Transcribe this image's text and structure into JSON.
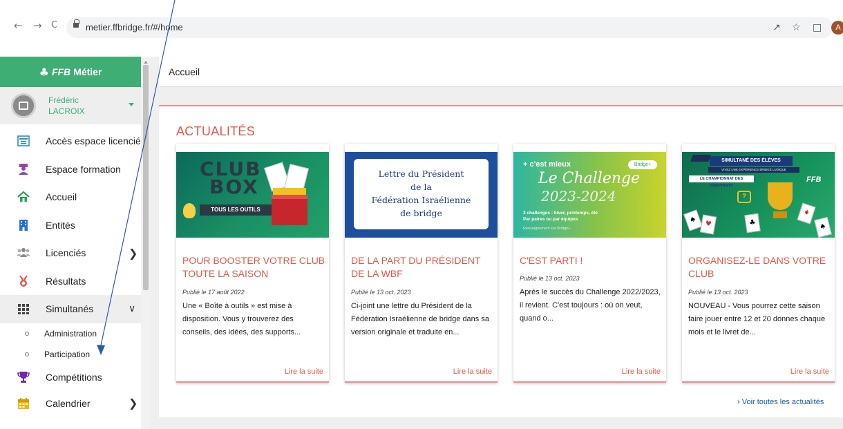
{
  "browser": {
    "url": "metier.ffbridge.fr/#/home",
    "back_icon": "←",
    "forward_icon": "→",
    "reload_icon": "C",
    "profile_initial": "A"
  },
  "sidebar": {
    "brand_ffb": "FFB",
    "brand_metier": "Métier",
    "user_first": "Frédéric",
    "user_last": "LACROIX",
    "items": [
      {
        "label": "Accès espace licencié",
        "icon": "id-card-icon"
      },
      {
        "label": "Espace formation",
        "icon": "graduate-icon"
      },
      {
        "label": "Accueil",
        "icon": "home-icon"
      },
      {
        "label": "Entités",
        "icon": "building-icon"
      },
      {
        "label": "Licenciés",
        "icon": "users-icon"
      },
      {
        "label": "Résultats",
        "icon": "medal-icon"
      },
      {
        "label": "Simultanés",
        "icon": "grid-icon"
      },
      {
        "label": "Compétitions",
        "icon": "trophy-icon"
      },
      {
        "label": "Calendrier",
        "icon": "calendar-icon"
      }
    ],
    "sub_items": [
      {
        "label": "Administration"
      },
      {
        "label": "Participation"
      }
    ]
  },
  "topbar": {
    "title": "Accueil"
  },
  "news": {
    "heading": "ACTUALITÉS",
    "see_all": "Voir toutes les actualités",
    "read_more": "Lire la suite",
    "cards": [
      {
        "title": "POUR BOOSTER VOTRE CLUB TOUTE LA SAISON",
        "date": "Publié le 17 août 2022",
        "text": "Une « Boîte à outils » est mise à disposition. Vous y trouverez des conseils, des idées, des supports...",
        "img_word1": "CLUB",
        "img_word2": "BOX",
        "img_tag": "TOUS LES OUTILS"
      },
      {
        "title": "DE LA PART DU PRÉSIDENT DE LA WBF",
        "date": "Publié le 13 oct. 2023",
        "text": "Ci-joint une lettre du Président de la Fédération Israélienne de bridge dans sa version originale et traduite en...",
        "img_line1": "Lettre du Président",
        "img_line2": "de la",
        "img_line3": "Fédération Israélienne",
        "img_line4": "de bridge"
      },
      {
        "title": "C'EST PARTI !",
        "date": "Publié le 13 oct. 2023",
        "text": "Après le succès du Challenge 2022/2023, il revient. C'est toujours : où on veut, quand o...",
        "img_top": "+ c'est mieux",
        "img_badge": "Bridge+",
        "img_word": "Le Challenge",
        "img_year": "2023-2024",
        "img_small1": "3 challenges : hiver, printemps, été",
        "img_small2": "Par paires ou par équipes",
        "img_foot": "Renseignement sur Bridge+"
      },
      {
        "title": "ORGANISEZ-LE DANS VOTRE CLUB",
        "date": "Publié le 13 oct. 2023",
        "text": "NOUVEAU - Vous pourrez cette saison faire jouer entre 12 et 20 donnes chaque mois et le livret de...",
        "img_banner1": "SIMULTANÉ DES ÉLÈVES",
        "img_banner2": "VIVEZ UNE EXPÉRIENCE BRIDGE LUDIQUE",
        "img_banner3": "LE CHAMPIONNAT DES DÉBUTANTS",
        "img_ffb": "FFB"
      }
    ]
  },
  "colors": {
    "brand_green": "#3fae75",
    "accent_red": "#e2574c",
    "link_blue": "#1a5aa5"
  }
}
